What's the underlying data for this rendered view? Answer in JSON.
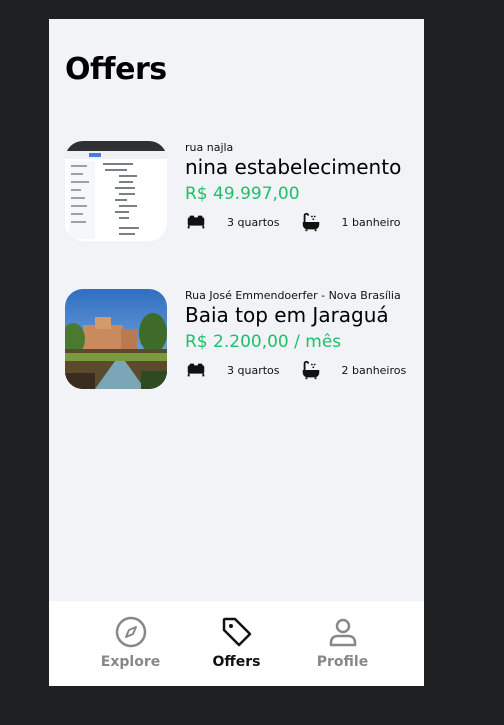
{
  "page": {
    "title": "Offers"
  },
  "offers": [
    {
      "address": "rua najla",
      "name": "nina estabelecimento",
      "price": "R$ 49.997,00",
      "bedrooms": "3 quartos",
      "bathrooms": "1 banheiro"
    },
    {
      "address": "Rua José Emmendoerfer - Nova Brasília",
      "name": "Baia top em Jaraguá",
      "price": "R$ 2.200,00 / mês",
      "bedrooms": "3 quartos",
      "bathrooms": "2 banheiros"
    }
  ],
  "nav": {
    "items": [
      {
        "label": "Explore",
        "icon": "compass-icon"
      },
      {
        "label": "Offers",
        "icon": "tag-icon"
      },
      {
        "label": "Profile",
        "icon": "user-icon"
      }
    ],
    "active": "Offers"
  },
  "colors": {
    "price": "#1fbf6a",
    "active": "#111111",
    "inactive": "#888888"
  }
}
